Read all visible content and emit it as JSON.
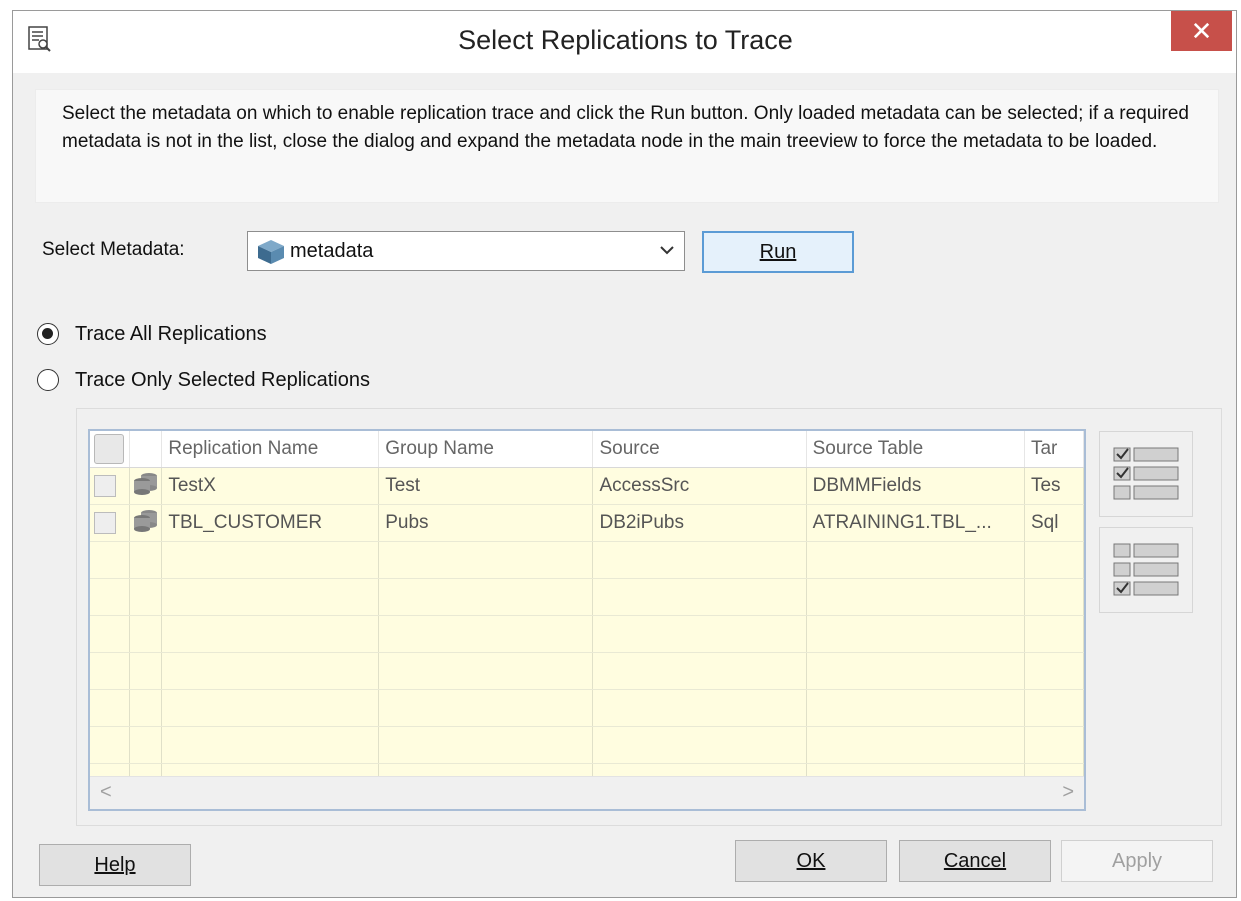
{
  "window": {
    "title": "Select Replications to Trace",
    "close_glyph": "✕"
  },
  "info_text": "Select the metadata on which to enable replication trace and click the Run button. Only loaded metadata can be selected; if a required metadata is not in the list, close the dialog and expand the metadata node in the main treeview to force the metadata to be loaded.",
  "metadata": {
    "label": "Select Metadata:",
    "selected": "metadata",
    "icon": "cube-icon"
  },
  "run_button": {
    "label": "Run",
    "underline": "R"
  },
  "trace_options": [
    {
      "label": "Trace All Replications",
      "checked": true
    },
    {
      "label": "Trace Only Selected Replications",
      "checked": false
    }
  ],
  "grid": {
    "columns": [
      "Replication Name",
      "Group Name",
      "Source",
      "Source Table",
      "Tar"
    ],
    "rows": [
      {
        "name": "TestX",
        "group": "Test",
        "source": "AccessSrc",
        "source_table": "DBMMFields",
        "target": "Tes"
      },
      {
        "name": "TBL_CUSTOMER",
        "group": "Pubs",
        "source": "DB2iPubs",
        "source_table": "ATRAINING1.TBL_...",
        "target": "Sql"
      }
    ],
    "scroll_left": "<",
    "scroll_right": ">"
  },
  "side_buttons": [
    {
      "name": "select-all-icon"
    },
    {
      "name": "select-none-icon"
    }
  ],
  "footer": {
    "help": "Help",
    "ok": "OK",
    "cancel": "Cancel",
    "apply": "Apply"
  }
}
